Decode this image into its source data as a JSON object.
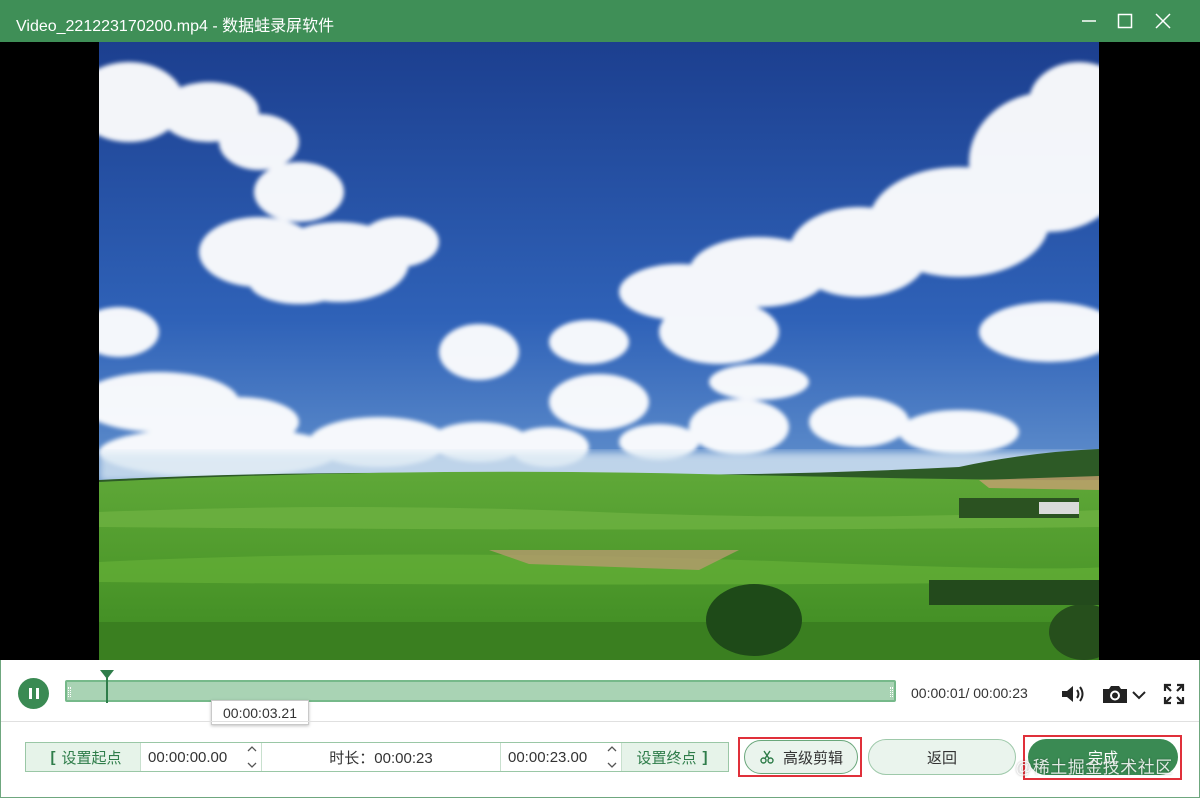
{
  "window": {
    "title": "Video_221223170200.mp4  -  数据蛙录屏软件"
  },
  "player": {
    "playback_progress": 0.04,
    "hover_time": "00:00:03.21",
    "time_readout": "00:00:01/ 00:00:23"
  },
  "trim": {
    "set_start_label": "设置起点",
    "start_time": "00:00:00.00",
    "duration_label": "时长：00:00:23",
    "end_time": "00:00:23.00",
    "set_end_label": "设置终点",
    "bracket_open": "[",
    "bracket_close": "]"
  },
  "buttons": {
    "advanced_edit": "高级剪辑",
    "back": "返回",
    "done": "完成"
  },
  "watermark": "@稀土掘金技术社区",
  "colors": {
    "accent": "#3a8a53",
    "titlebar": "#3f8f57",
    "highlight": "#e0303a"
  }
}
